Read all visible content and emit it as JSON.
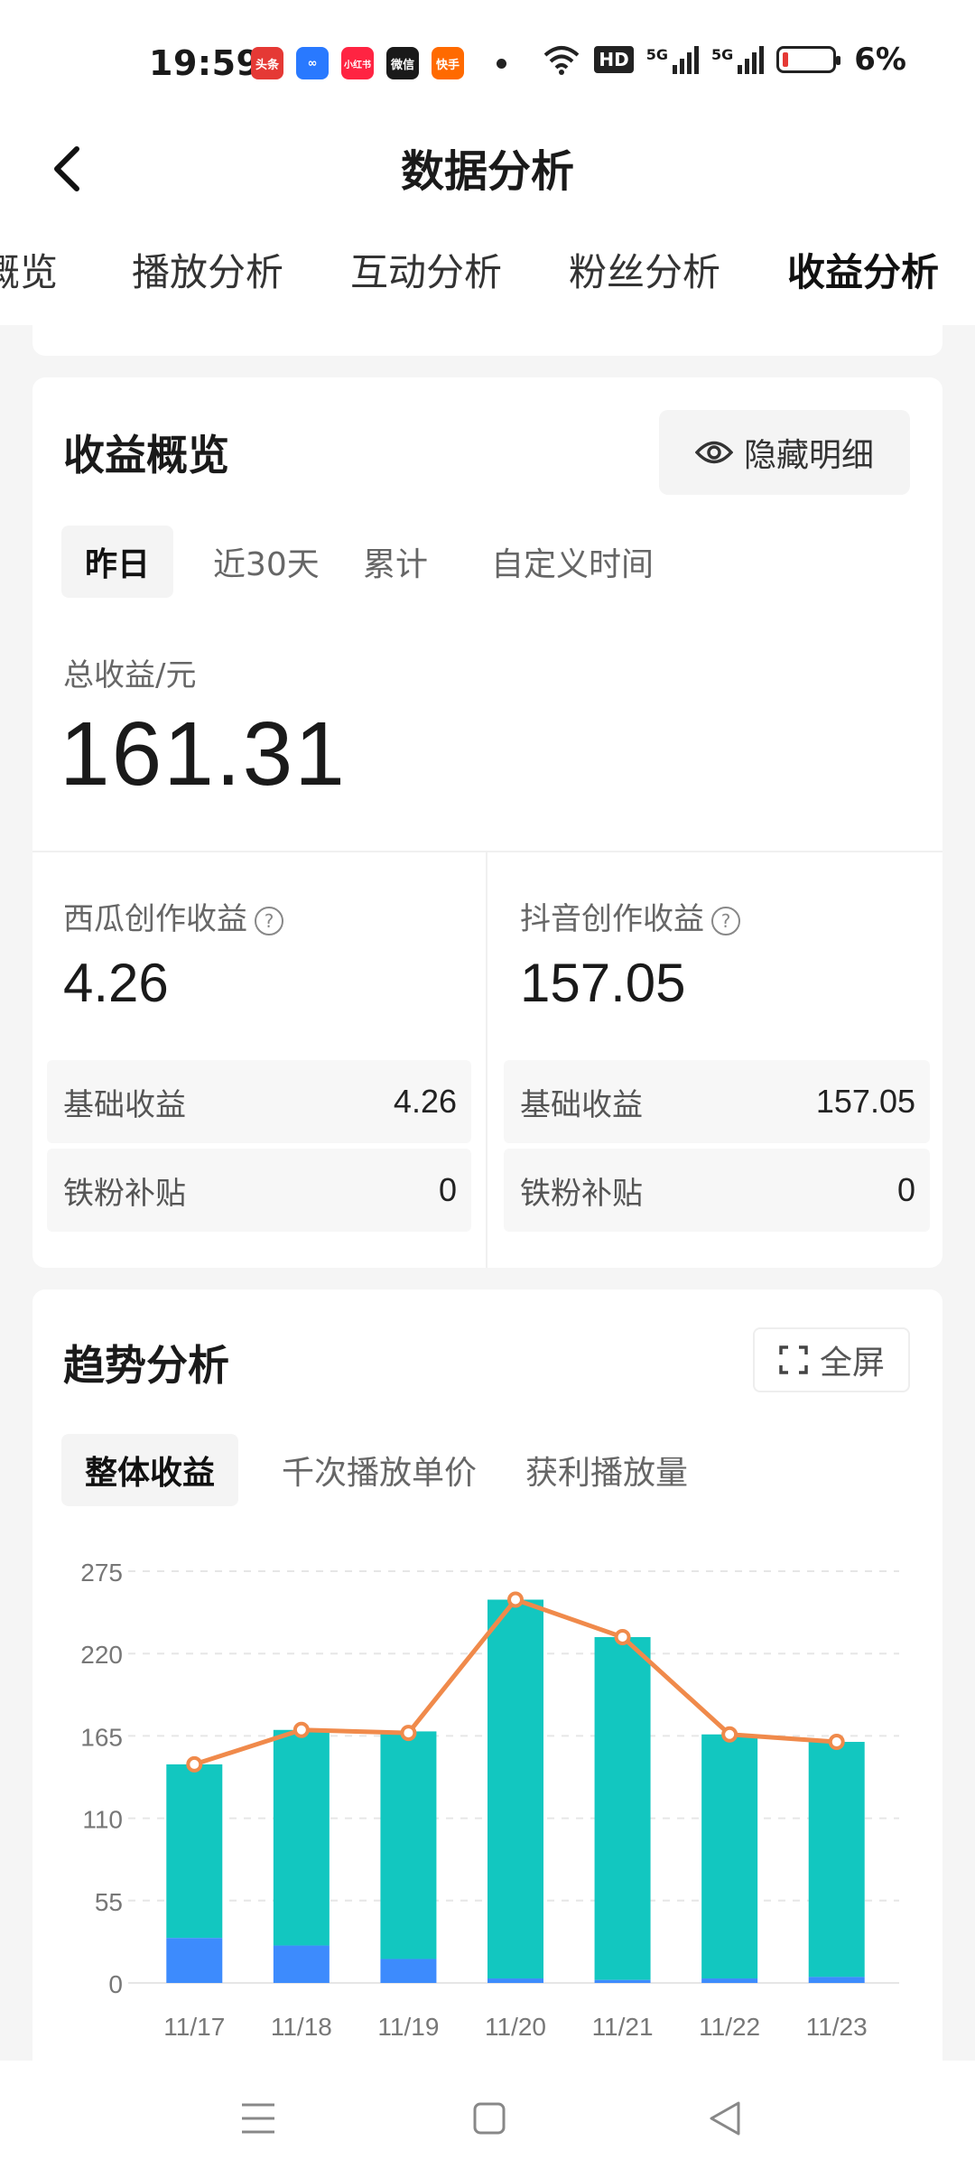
{
  "status": {
    "time": "19:59",
    "apps": [
      {
        "name": "头条",
        "color": "#e53935"
      },
      {
        "name": "∞",
        "color": "#2979ff"
      },
      {
        "name": "小红书",
        "color": "#ff2442"
      },
      {
        "name": "微信",
        "color": "#1a1a1a"
      },
      {
        "name": "快手",
        "color": "#ff6a00"
      }
    ],
    "hd": "HD",
    "net1": "5G",
    "net2": "5G",
    "battery": "6%"
  },
  "nav": {
    "title": "数据分析"
  },
  "tabs": [
    "概览",
    "播放分析",
    "互动分析",
    "粉丝分析",
    "收益分析"
  ],
  "revenue": {
    "title": "收益概览",
    "hide_label": "隐藏明细",
    "periods": [
      "昨日",
      "近30天",
      "累计",
      "自定义时间"
    ],
    "total_label": "总收益/元",
    "total_value": "161.31",
    "xigua": {
      "label": "西瓜创作收益",
      "value": "4.26",
      "rows": [
        {
          "label": "基础收益",
          "value": "4.26"
        },
        {
          "label": "铁粉补贴",
          "value": "0"
        }
      ]
    },
    "douyin": {
      "label": "抖音创作收益",
      "value": "157.05",
      "rows": [
        {
          "label": "基础收益",
          "value": "157.05"
        },
        {
          "label": "铁粉补贴",
          "value": "0"
        }
      ]
    }
  },
  "trend": {
    "title": "趋势分析",
    "fullscreen_label": "全屏",
    "metric_tabs": [
      "整体收益",
      "千次播放单价",
      "获利播放量"
    ]
  },
  "chart_data": {
    "type": "bar",
    "categories": [
      "11/17",
      "11/18",
      "11/19",
      "11/20",
      "11/21",
      "11/22",
      "11/23"
    ],
    "yticks": [
      0,
      55,
      110,
      165,
      220,
      275
    ],
    "ylim": [
      0,
      275
    ],
    "stacked_series": [
      {
        "color": "#3d8bfd",
        "values": [
          30,
          25,
          16,
          3,
          2,
          3,
          4
        ]
      },
      {
        "color": "#12c7c0",
        "values": [
          116,
          144,
          152,
          253,
          229,
          163,
          157
        ]
      }
    ],
    "line_series": {
      "color": "#f08a4b",
      "values": [
        146,
        169,
        167,
        256,
        231,
        166,
        161
      ]
    },
    "grid": true
  },
  "colors": {
    "accent": "#12c7c0",
    "secondary": "#3d8bfd",
    "line": "#f08a4b"
  }
}
